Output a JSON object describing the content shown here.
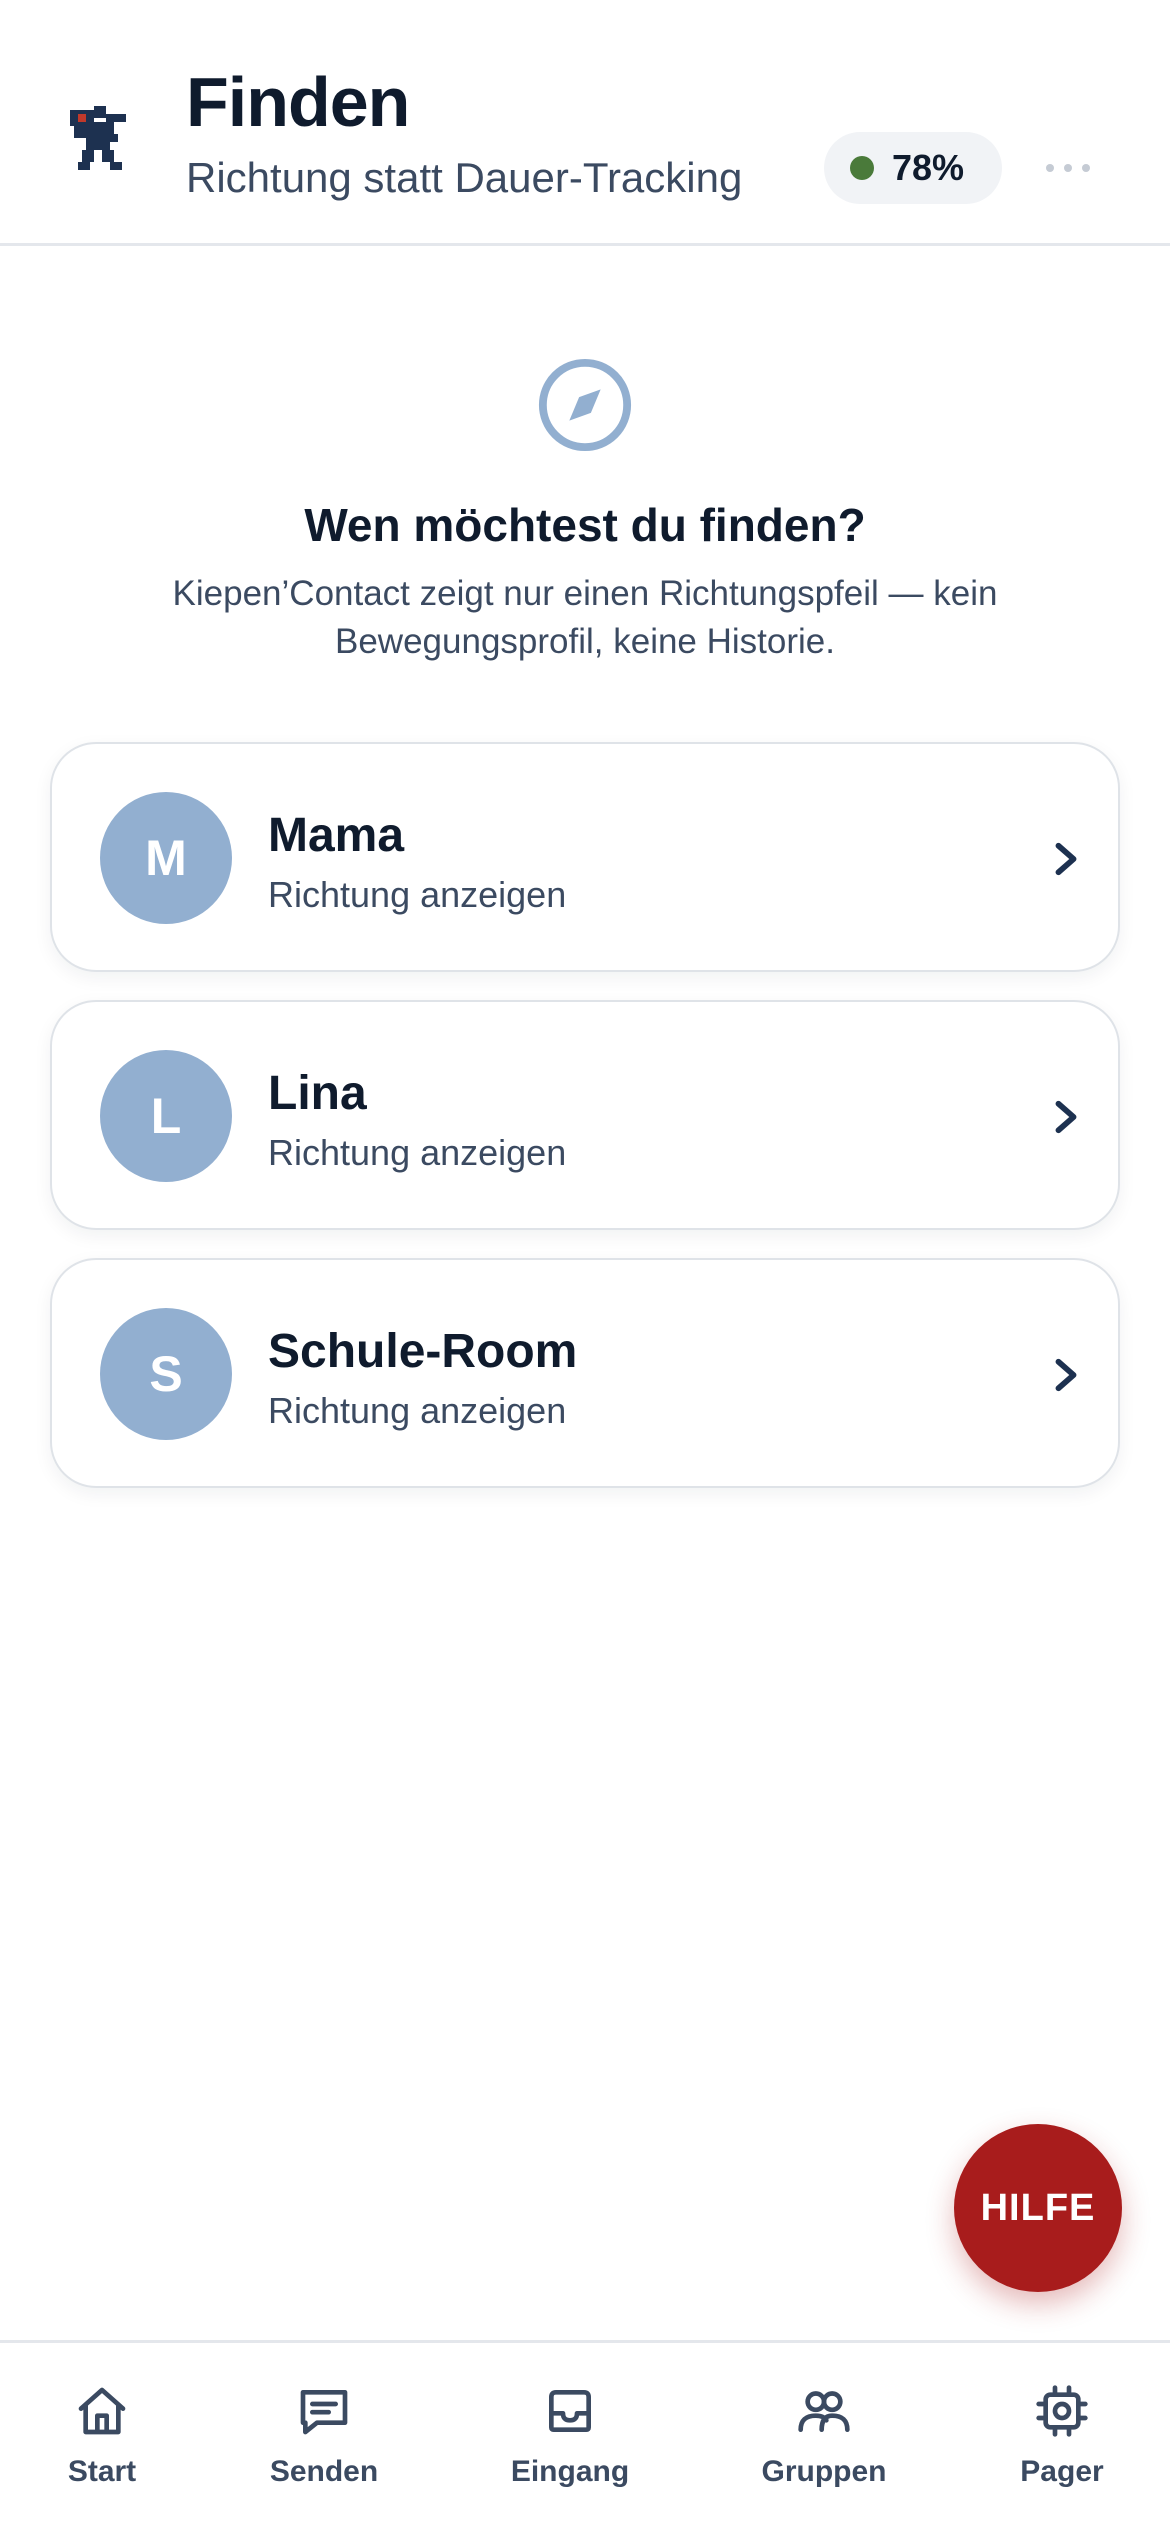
{
  "header": {
    "title": "Finden",
    "subtitle": "Richtung statt Dauer-Tracking",
    "battery": "78%",
    "status_color": "#4a7a3a"
  },
  "intro": {
    "icon": "compass-icon",
    "question": "Wen möchtest du finden?",
    "explanation": "Kiepen’Contact zeigt nur einen Richtungspfeil — kein Bewegungsprofil, keine Historie."
  },
  "contacts": [
    {
      "initial": "M",
      "name": "Mama",
      "action": "Richtung anzeigen"
    },
    {
      "initial": "L",
      "name": "Lina",
      "action": "Richtung anzeigen"
    },
    {
      "initial": "S",
      "name": "Schule-Room",
      "action": "Richtung anzeigen"
    }
  ],
  "fab": {
    "label": "HILFE",
    "color": "#a81c1c"
  },
  "tabs": [
    {
      "label": "Start",
      "icon": "home-icon"
    },
    {
      "label": "Senden",
      "icon": "message-icon"
    },
    {
      "label": "Eingang",
      "icon": "inbox-icon"
    },
    {
      "label": "Gruppen",
      "icon": "group-icon"
    },
    {
      "label": "Pager",
      "icon": "chip-icon"
    }
  ],
  "colors": {
    "accent": "#92afd0",
    "text": "#0f1b2d",
    "muted": "#3b4a61"
  }
}
